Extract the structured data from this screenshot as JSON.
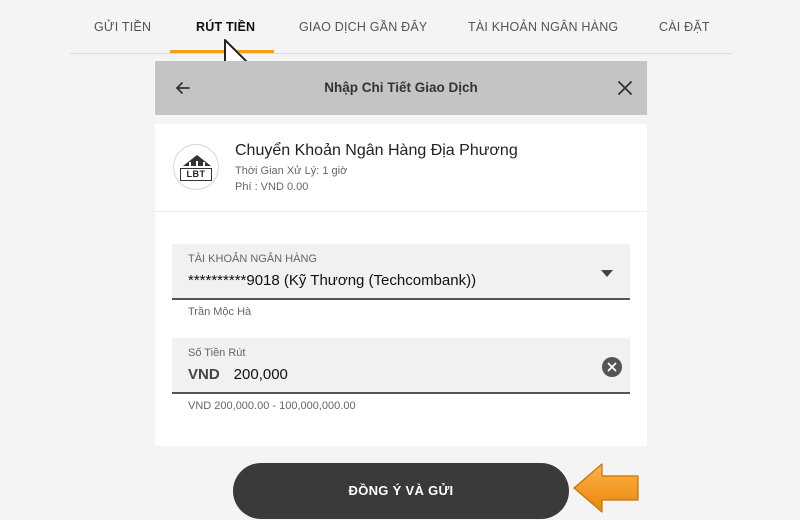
{
  "nav": {
    "tabs": [
      {
        "label": "GỬI TIỀN",
        "active": false
      },
      {
        "label": "RÚT TIỀN",
        "active": true
      },
      {
        "label": "GIAO DỊCH GẦN ĐÂY",
        "active": false
      },
      {
        "label": "TÀI KHOẢN NGÂN HÀNG",
        "active": false
      },
      {
        "label": "CÀI ĐẶT",
        "active": false
      }
    ]
  },
  "dialog": {
    "title": "Nhập Chi Tiết Giao Dịch",
    "back_icon": "arrow-left-icon",
    "close_icon": "close-icon"
  },
  "bank": {
    "logo_text": "LBT",
    "name": "Chuyển Khoản Ngân Hàng Địa Phương",
    "processing_time": "Thời Gian Xử Lý: 1 giờ",
    "fee": "Phí : VND 0.00"
  },
  "bank_account": {
    "label": "TÀI KHOẢN NGÂN HÀNG",
    "value": "**********9018 (Kỹ Thương (Techcombank))",
    "holder": "Trần Mộc Hà"
  },
  "amount": {
    "label": "Số Tiền Rút",
    "currency": "VND",
    "value": "200,000",
    "range_hint": "VND 200,000.00 - 100,000,000.00"
  },
  "submit_label": "ĐỒNG Ý VÀ GỬI",
  "colors": {
    "accent": "#f5a01a",
    "button": "#3a3a3a",
    "header_bg": "#c4c4c4"
  }
}
